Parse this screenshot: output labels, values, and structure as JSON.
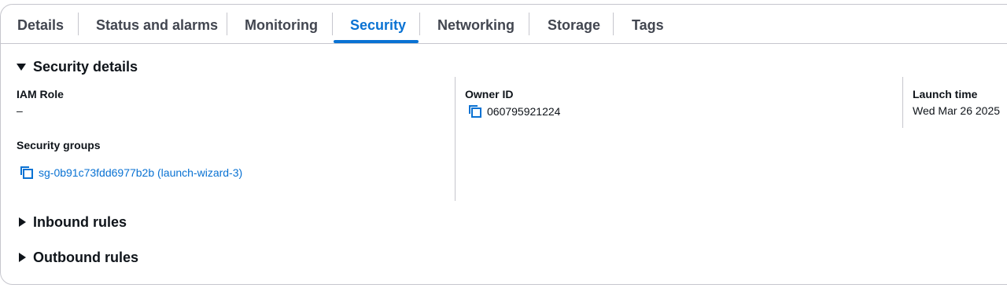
{
  "tabs": [
    {
      "label": "Details"
    },
    {
      "label": "Status and alarms"
    },
    {
      "label": "Monitoring"
    },
    {
      "label": "Security"
    },
    {
      "label": "Networking"
    },
    {
      "label": "Storage"
    },
    {
      "label": "Tags"
    }
  ],
  "active_tab": "Security",
  "security_details": {
    "title": "Security details",
    "iam_role": {
      "label": "IAM Role",
      "value": "–"
    },
    "owner_id": {
      "label": "Owner ID",
      "value": "060795921224"
    },
    "launch_time": {
      "label": "Launch time",
      "value": "Wed Mar 26 2025"
    },
    "security_groups": {
      "label": "Security groups",
      "value": "sg-0b91c73fdd6977b2b (launch-wizard-3)"
    }
  },
  "inbound_rules": {
    "title": "Inbound rules"
  },
  "outbound_rules": {
    "title": "Outbound rules"
  },
  "colors": {
    "accent": "#0972d3",
    "text": "#0f141a",
    "tab_text": "#424650",
    "border": "#c6c6cd"
  }
}
